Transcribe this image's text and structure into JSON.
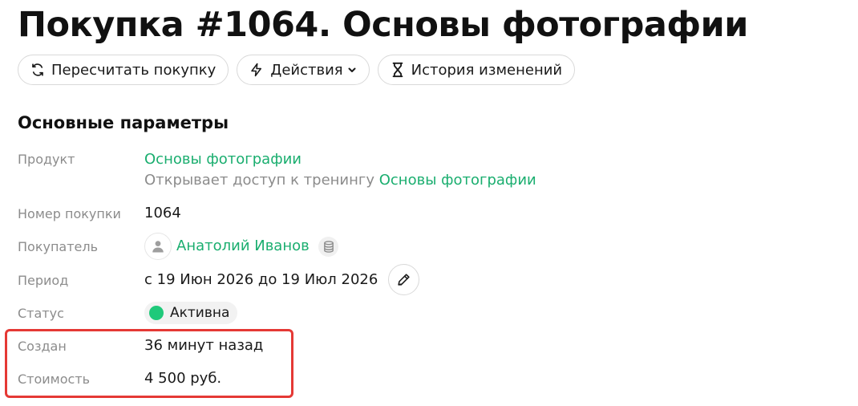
{
  "page": {
    "title": "Покупка #1064. Основы фотографии"
  },
  "toolbar": {
    "recalc_label": "Пересчитать покупку",
    "actions_label": "Действия",
    "history_label": "История изменений",
    "recalc_icon": "refresh-icon",
    "actions_icon": "lightning-icon",
    "actions_chevron": "chevron-down-icon",
    "history_icon": "hourglass-icon"
  },
  "section": {
    "title": "Основные параметры"
  },
  "fields": {
    "product": {
      "label": "Продукт",
      "value": "Основы фотографии",
      "access_prefix": "Открывает доступ к тренингу",
      "access_training": "Основы фотографии"
    },
    "order_number": {
      "label": "Номер покупки",
      "value": "1064"
    },
    "buyer": {
      "label": "Покупатель",
      "name": "Анатолий Иванов",
      "avatar_icon": "user-icon",
      "badge_icon": "database-icon"
    },
    "period": {
      "label": "Период",
      "value": "с 19 Июн 2026 до 19 Июл 2026",
      "edit_icon": "pencil-icon"
    },
    "status": {
      "label": "Статус",
      "value": "Активна",
      "color": "#1fc97a"
    },
    "created": {
      "label": "Создан",
      "value": "36 минут назад"
    },
    "cost": {
      "label": "Стоимость",
      "value": "4 500 руб."
    }
  },
  "colors": {
    "link": "#1aae6f",
    "highlight": "#e53935",
    "muted": "#8c8c8c"
  }
}
